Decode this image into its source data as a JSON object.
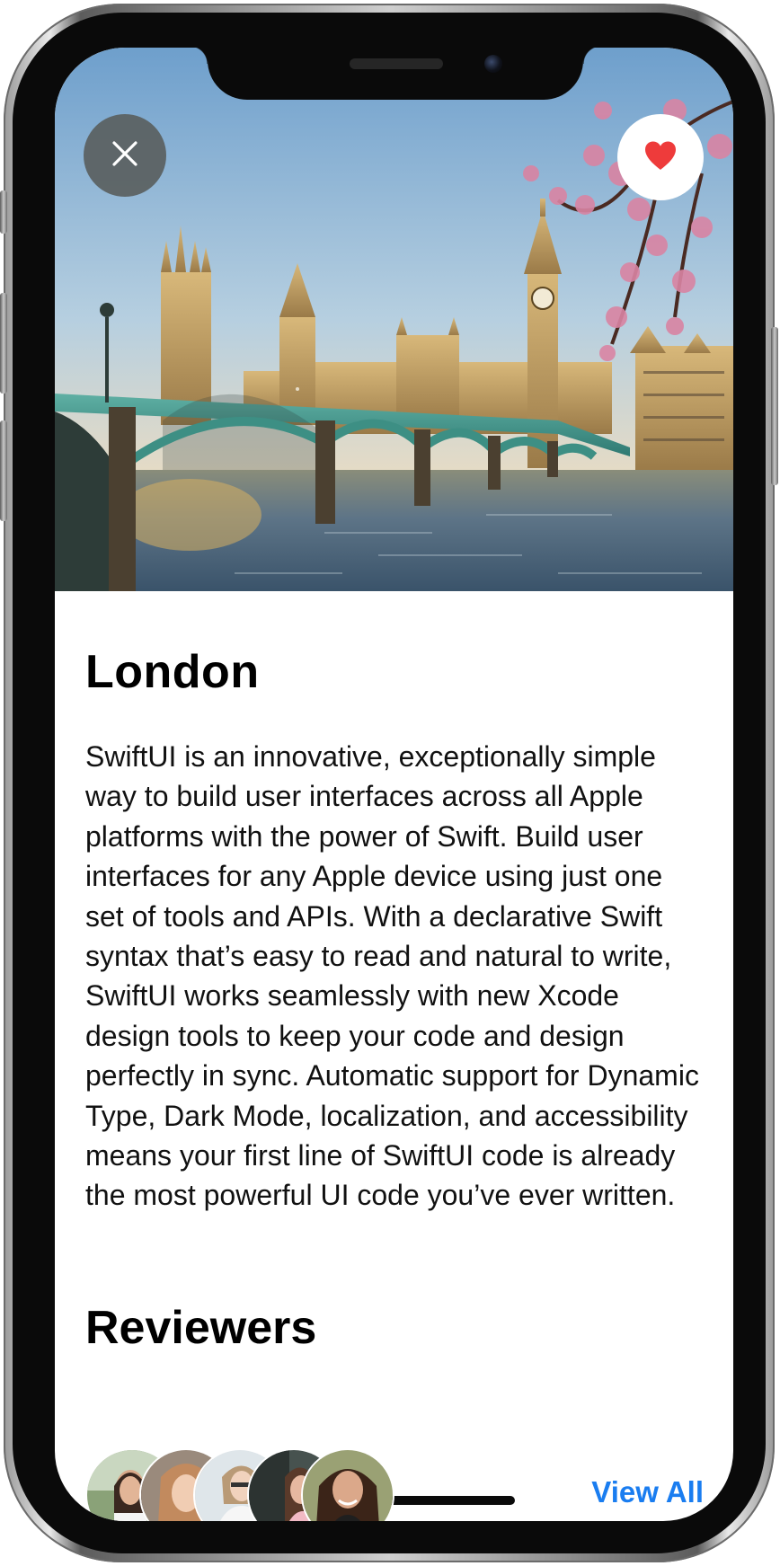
{
  "detail": {
    "title": "London",
    "description": "SwiftUI is an innovative, exceptionally simple way to build user interfaces across all Apple platforms with the power of Swift. Build user interfaces for any Apple device using just one set of tools and APIs. With a declarative Swift syntax that’s easy to read and natural to write, SwiftUI works seamlessly with new Xcode design tools to keep your code and design perfectly in sync. Automatic support for Dynamic Type, Dark Mode, localization, and accessibility means your first line of SwiftUI code is already the most powerful UI code you’ve ever written.",
    "hero_image": "westminster-bridge-big-ben-photo"
  },
  "toolbar": {
    "close_icon": "xmark-icon",
    "favorite_icon": "heart-fill-icon",
    "favorite_color": "#ee3b3b"
  },
  "reviewers": {
    "title": "Reviewers",
    "view_all_label": "View All",
    "link_color": "#1a7df0",
    "avatars": [
      {
        "image": "reviewer-photo-1"
      },
      {
        "image": "reviewer-photo-2"
      },
      {
        "image": "reviewer-photo-3"
      },
      {
        "image": "reviewer-photo-4"
      },
      {
        "image": "reviewer-photo-5"
      }
    ]
  }
}
